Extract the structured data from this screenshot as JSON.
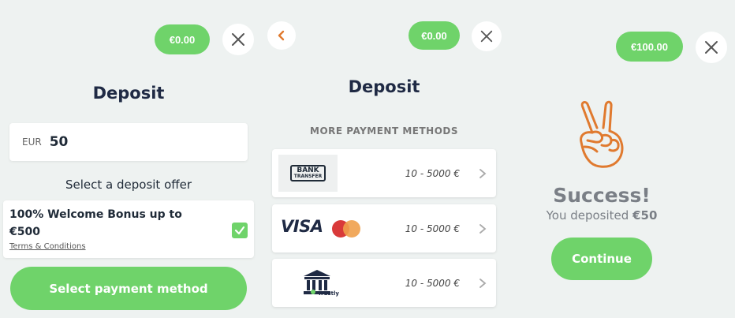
{
  "panel1": {
    "balance": "€0.00",
    "title": "Deposit",
    "currency": "EUR",
    "amount": "50",
    "offer_heading": "Select a deposit offer",
    "offer_line1": "100% Welcome Bonus up to",
    "offer_line2": "€500",
    "terms_link": "Terms & Conditions",
    "select_button": "Select payment method"
  },
  "panel2": {
    "balance": "€0.00",
    "title": "Deposit",
    "section_heading": "MORE PAYMENT METHODS",
    "methods": [
      {
        "name": "BANK TRANSFER",
        "logo_line1": "BANK",
        "logo_line2": "TRANSFER",
        "range": "10 - 5000 €"
      },
      {
        "name": "VISA",
        "logo_text": "VISA",
        "range": "10 - 5000 €"
      },
      {
        "name": "Trustly",
        "logo_text": "Trustly",
        "range": "10 - 5000 €"
      }
    ]
  },
  "panel3": {
    "balance": "€100.00",
    "success_title": "Success!",
    "deposited_prefix": "You deposited",
    "deposited_amount": "€50",
    "continue_button": "Continue"
  },
  "colors": {
    "accent_green": "#6fd36a",
    "background": "#eef2f1",
    "back_arrow": "#e07a2f",
    "hand_outline": "#e07a2f"
  },
  "icons": [
    "close-icon",
    "back-arrow-icon",
    "checkbox-checked-icon",
    "chevron-right-icon",
    "bank-transfer-logo",
    "visa-logo",
    "mastercard-logo",
    "trustly-logo",
    "peace-hand-icon"
  ]
}
